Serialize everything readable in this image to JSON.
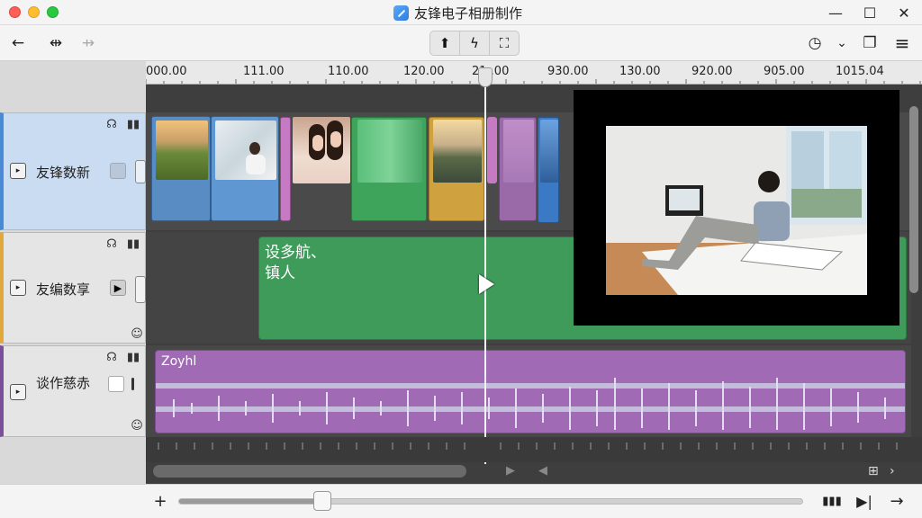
{
  "window": {
    "title": "友锋电子相册制作",
    "minimize": "—",
    "maximize": "☐",
    "close": "✕"
  },
  "toolbar": {
    "back": "←",
    "split": "⇹",
    "split_disabled": "⇸",
    "group": [
      "⬆",
      "ϟ",
      "⛶"
    ],
    "clock": "◷",
    "dropdown": "⌄",
    "window_icon": "❐",
    "menu": "≡"
  },
  "ruler": {
    "labels": [
      "000.00",
      "111.00",
      "110.00",
      "120.00",
      "21 .00",
      "930.00",
      "130.00",
      "920.00",
      "905.00",
      "1015.04"
    ]
  },
  "tracks": [
    {
      "label": "友锋数新",
      "color": "#4a89d6"
    },
    {
      "label": "友编数享",
      "color": "#e1a93b"
    },
    {
      "label": "谈作慈赤",
      "color": "#7b4f9b"
    }
  ],
  "clips": {
    "title_text": "设多航、\n镇人",
    "audio_label": "Zoyhl"
  },
  "zoom": {
    "level": 0.23
  },
  "bottom": {
    "add": "+",
    "bars": "▮▮▮",
    "play": "▶|",
    "forward": "→"
  }
}
